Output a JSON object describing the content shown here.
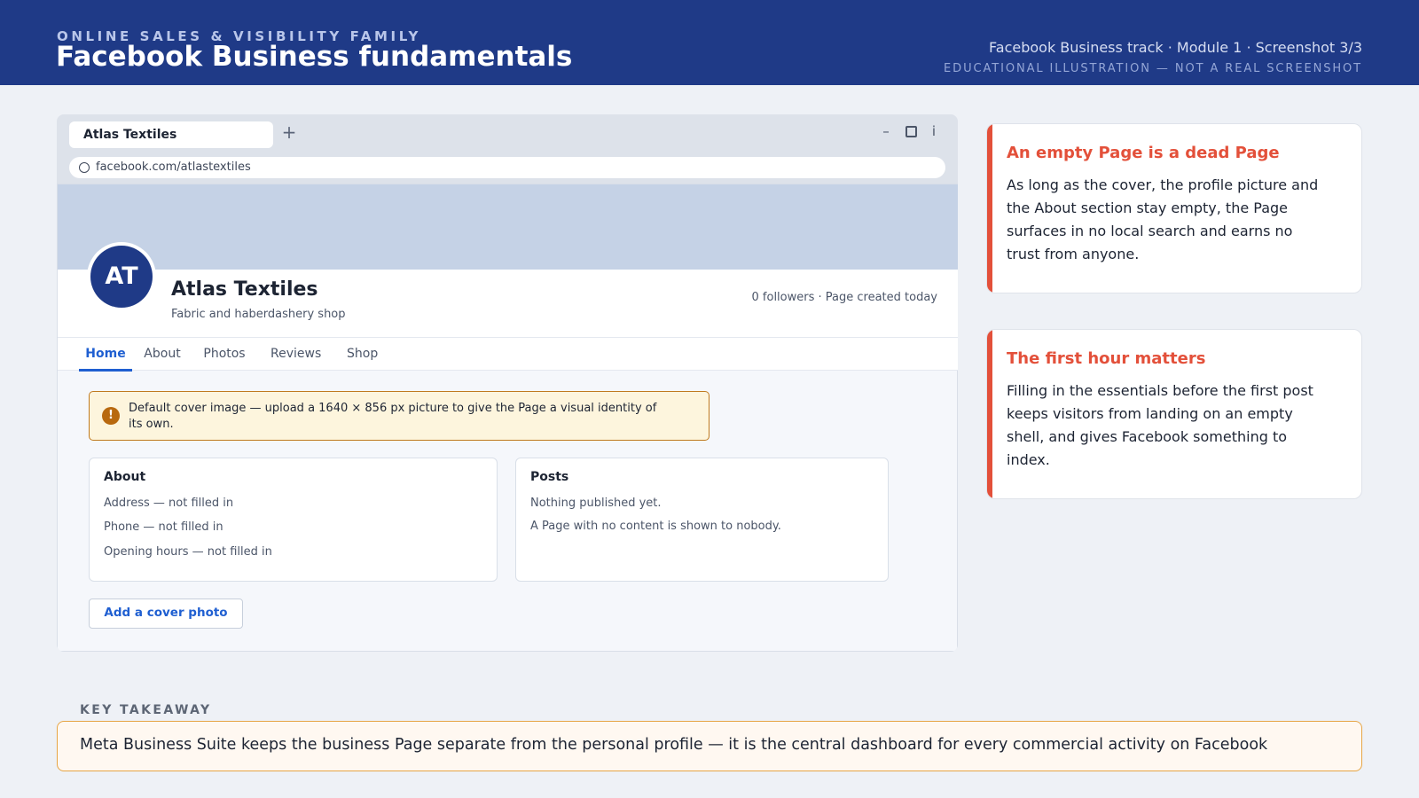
{
  "banner": {
    "eyebrow": "ONLINE SALES & VISIBILITY FAMILY",
    "title": "Facebook Business fundamentals",
    "meta": "Facebook Business track · Module 1 · Screenshot 3/3",
    "disclaimer": "EDUCATIONAL ILLUSTRATION — NOT A REAL SCREENSHOT"
  },
  "browser": {
    "tab_title": "Atlas Textiles",
    "new_tab": "+",
    "minimize": "–",
    "info": "i",
    "url": "facebook.com/atlastextiles"
  },
  "page": {
    "avatar_initials": "AT",
    "name": "Atlas Textiles",
    "category": "Fabric and haberdashery shop",
    "stats": "0 followers · Page created today",
    "nav": [
      "Home",
      "About",
      "Photos",
      "Reviews",
      "Shop"
    ],
    "active_nav": "Home",
    "alert": {
      "icon": "!",
      "text": "Default cover image — upload a 1640 × 856 px picture to give the Page a visual identity of its own."
    },
    "about": {
      "title": "About",
      "lines": [
        "Address — not filled in",
        "Phone — not filled in",
        "Opening hours — not filled in"
      ]
    },
    "posts": {
      "title": "Posts",
      "lines": [
        "Nothing published yet.",
        "A Page with no content is shown to nobody."
      ]
    },
    "cover_button": "Add a cover photo"
  },
  "notes": [
    {
      "title": "An empty Page is a dead Page",
      "body": "As long as the cover, the profile picture and the About section stay empty, the Page surfaces in no local search and earns no trust from anyone."
    },
    {
      "title": "The first hour matters",
      "body": "Filling in the essentials before the first post keeps visitors from landing on an empty shell, and gives Facebook something to index."
    }
  ],
  "takeaway": {
    "label": "KEY TAKEAWAY",
    "text": "Meta Business Suite keeps the business Page separate from the personal profile — it is the central dashboard for every commercial activity on Facebook"
  },
  "colors": {
    "banner": "#1f3a87",
    "accent_red": "#e3503a",
    "link_blue": "#1f5fd1",
    "warning": "#b8690f",
    "takeaway_border": "#e6a545"
  }
}
